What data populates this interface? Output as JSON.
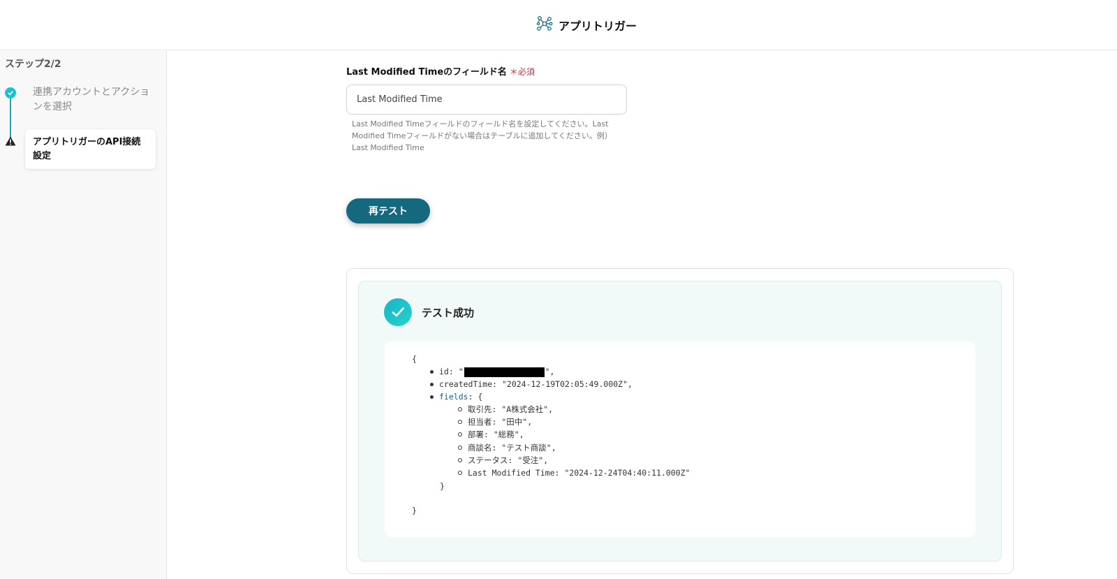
{
  "header": {
    "title": "アプリトリガー",
    "icon": "network-nodes-icon"
  },
  "sidebar": {
    "step_indicator": "ステップ2/2",
    "steps": [
      {
        "label": "連携アカウントとアクションを選択",
        "status": "completed"
      },
      {
        "label": "アプリトリガーのAPI接続設定",
        "status": "warning"
      }
    ]
  },
  "form": {
    "field_label": "Last Modified Timeのフィールド名",
    "required_mark": "＊",
    "required_label": "必須",
    "field_value": "Last Modified Time",
    "help_text": "Last Modified Timeフィールドのフィールド名を設定してください。Last Modified Timeフィールドがない場合はテーブルに追加してください。例）Last Modified Time",
    "retest_button": "再テスト"
  },
  "result": {
    "status_text": "テスト成功",
    "json_lines": {
      "open_brace": "{",
      "id_prefix": "id: \"",
      "id_suffix": "\",",
      "created_time": "createdTime: \"2024-12-19T02:05:49.000Z\",",
      "fields_key": "fields",
      "fields_open": ": {",
      "field_items": [
        "取引先: \"A株式会社\",",
        "担当者: \"田中\",",
        "部署: \"総務\",",
        "商談名: \"テスト商談\",",
        "ステータス: \"受注\",",
        "Last Modified Time: \"2024-12-24T04:40:11.000Z\""
      ],
      "fields_close": "}",
      "close_brace": "}"
    }
  },
  "colors": {
    "accent": "#14697f",
    "success": "#1fc1cf",
    "required": "#e5233d",
    "panel_bg": "#f1faf8"
  }
}
